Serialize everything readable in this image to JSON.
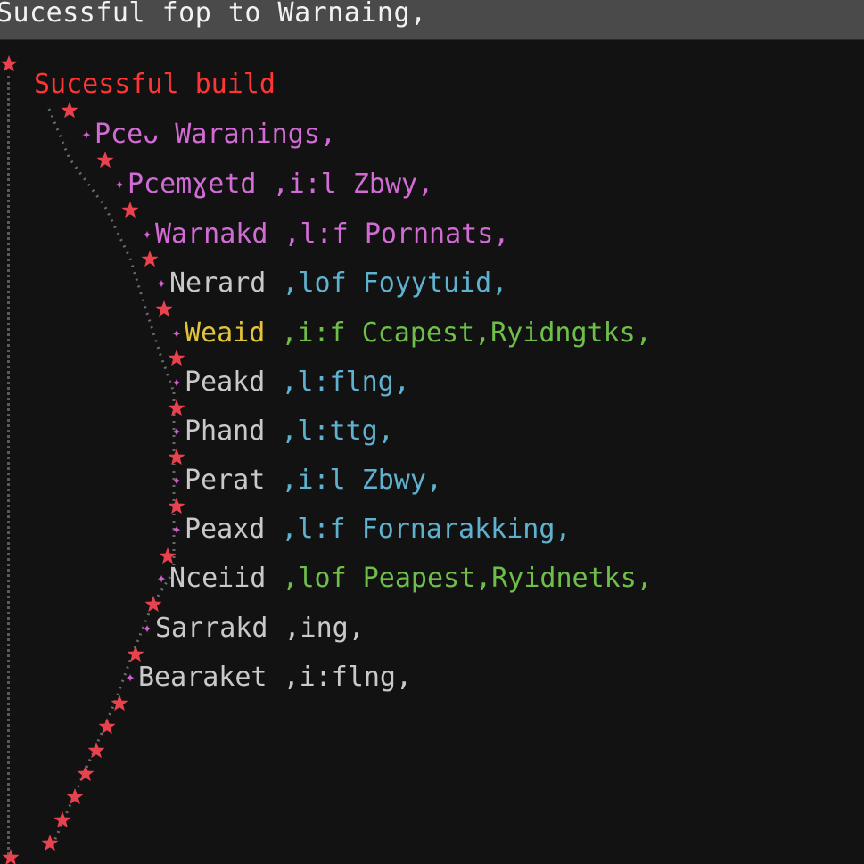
{
  "window": {
    "title": "Sucessful fop to Warnaing,"
  },
  "root": {
    "label": "Sucessful build"
  },
  "icons": {
    "star": "star-icon",
    "bullet": "sparkle-icon"
  },
  "colors": {
    "star": "#e8424f",
    "root": "#ff3535",
    "magenta": "#d26bd6",
    "green": "#6fbe4a",
    "cyan": "#5fb2cf",
    "yellow": "#e2c43a",
    "gray": "#c9c9c9"
  },
  "entries": [
    {
      "name": "Pceᴗ Waranings,",
      "sep": "",
      "detail": ""
    },
    {
      "name": "Pcemɣetd",
      "sep": ",i:l",
      "detail": "Zbwy,"
    },
    {
      "name": "Warnakd",
      "sep": ",l:f",
      "detail": "Pornnats,"
    },
    {
      "name": "Nerard",
      "sep": ",lof",
      "detail": "Foyytuid,"
    },
    {
      "name": "Weaid",
      "sep": ",i:f",
      "detail": "Ccapest,Ryidngtks,"
    },
    {
      "name": "Peakd",
      "sep": ",l:flng,",
      "detail": ""
    },
    {
      "name": "Phand",
      "sep": ",l:ttg,",
      "detail": ""
    },
    {
      "name": "Perat",
      "sep": ",i:l",
      "detail": "Zbwy,"
    },
    {
      "name": "Peaxd",
      "sep": ",l:f",
      "detail": "Fornarakking,"
    },
    {
      "name": "Nceiid",
      "sep": ",lof",
      "detail": "Peapest,Ryidnetks,"
    },
    {
      "name": "Sarrakd",
      "sep": ",ing,",
      "detail": ""
    },
    {
      "name": "Bearaket",
      "sep": ",i:flng,",
      "detail": ""
    }
  ]
}
